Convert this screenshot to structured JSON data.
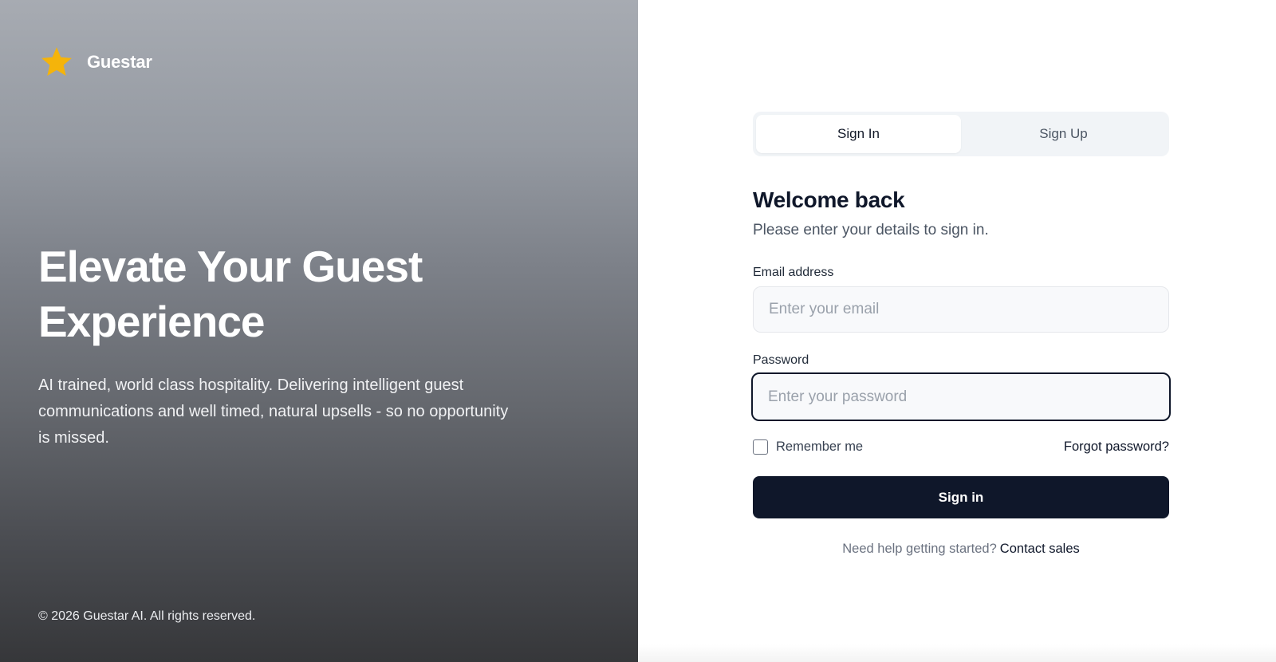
{
  "brand": {
    "name": "Guestar",
    "logo_icon": "star-icon",
    "logo_color": "#f5b40a"
  },
  "hero": {
    "title": "Elevate Your Guest Experience",
    "subtitle": "AI trained, world class hospitality. Delivering intelligent guest communications and well timed, natural upsells - so no opportunity is missed.",
    "footer": "© 2026 Guestar AI. All rights reserved."
  },
  "auth": {
    "tabs": [
      {
        "label": "Sign In",
        "active": true
      },
      {
        "label": "Sign Up",
        "active": false
      }
    ],
    "heading": "Welcome back",
    "subheading": "Please enter your details to sign in.",
    "email": {
      "label": "Email address",
      "placeholder": "Enter your email",
      "value": ""
    },
    "password": {
      "label": "Password",
      "placeholder": "Enter your password",
      "value": "",
      "focused": true
    },
    "remember_label": "Remember me",
    "remember_checked": false,
    "forgot_label": "Forgot password?",
    "submit_label": "Sign in",
    "help_text": "Need help getting started?",
    "help_link": "Contact sales"
  },
  "colors": {
    "primary": "#0f172a",
    "accent": "#f5b40a"
  }
}
